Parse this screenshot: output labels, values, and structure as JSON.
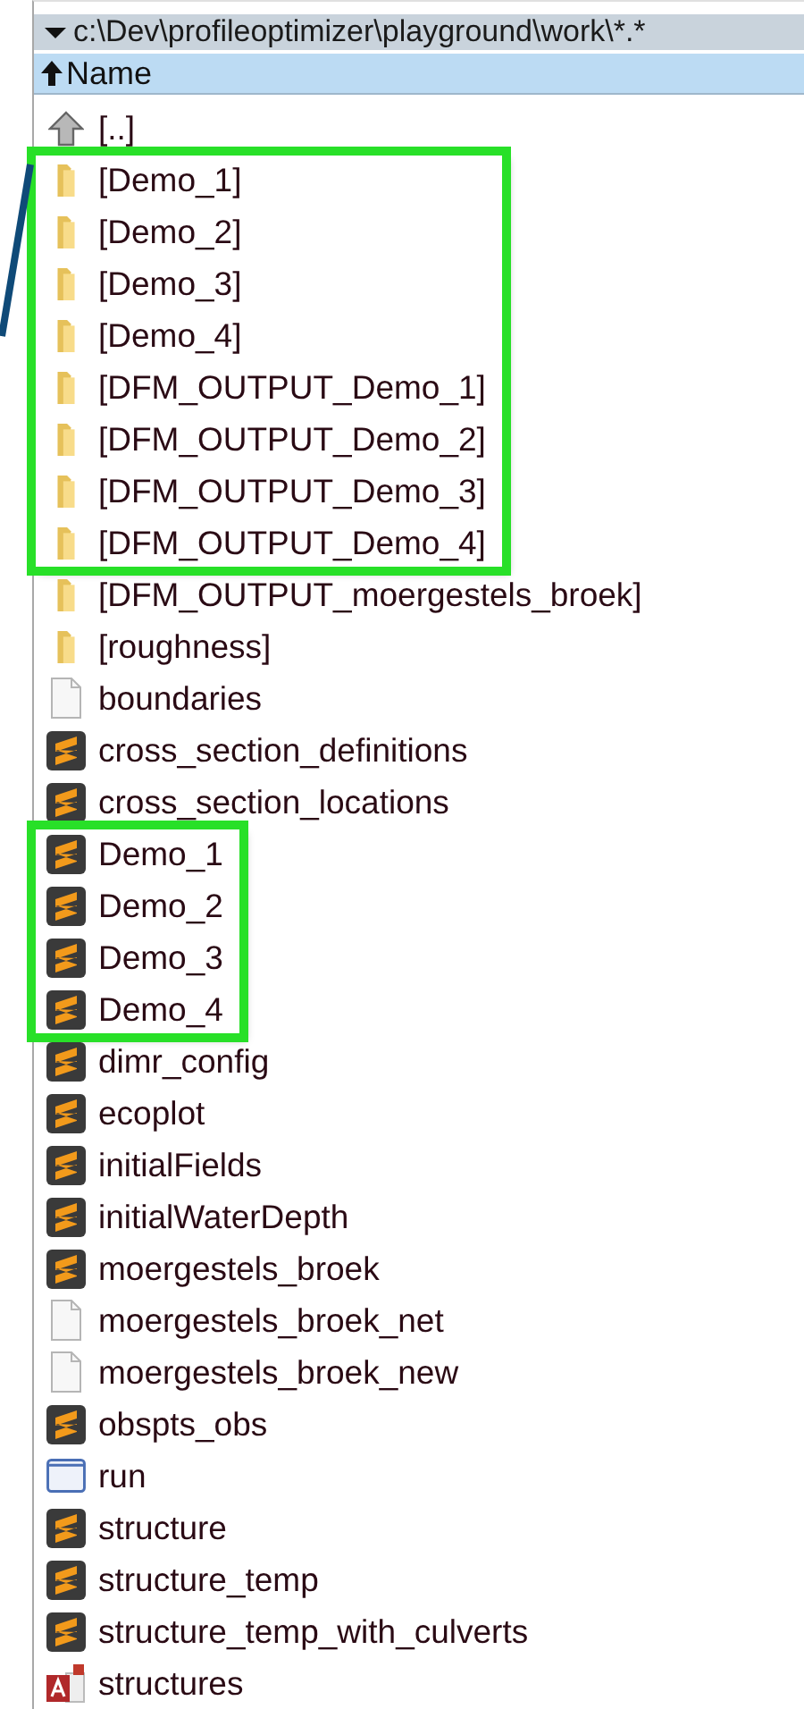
{
  "path_bar": {
    "path": "c:\\Dev\\profileoptimizer\\playground\\work\\*.*"
  },
  "header": {
    "column": "Name"
  },
  "sections": [
    {
      "highlighted": false,
      "items": [
        {
          "name": "[..]",
          "kind": "parent"
        }
      ]
    },
    {
      "highlighted": true,
      "items": [
        {
          "name": "[Demo_1]",
          "kind": "folder"
        },
        {
          "name": "[Demo_2]",
          "kind": "folder"
        },
        {
          "name": "[Demo_3]",
          "kind": "folder"
        },
        {
          "name": "[Demo_4]",
          "kind": "folder"
        },
        {
          "name": "[DFM_OUTPUT_Demo_1]",
          "kind": "folder"
        },
        {
          "name": "[DFM_OUTPUT_Demo_2]",
          "kind": "folder"
        },
        {
          "name": "[DFM_OUTPUT_Demo_3]",
          "kind": "folder"
        },
        {
          "name": "[DFM_OUTPUT_Demo_4]",
          "kind": "folder"
        }
      ]
    },
    {
      "highlighted": false,
      "items": [
        {
          "name": "[DFM_OUTPUT_moergestels_broek]",
          "kind": "folder"
        },
        {
          "name": "[roughness]",
          "kind": "folder"
        },
        {
          "name": "boundaries",
          "kind": "file"
        },
        {
          "name": "cross_section_definitions",
          "kind": "sublime"
        },
        {
          "name": "cross_section_locations",
          "kind": "sublime"
        }
      ]
    },
    {
      "highlighted": true,
      "items": [
        {
          "name": "Demo_1",
          "kind": "sublime"
        },
        {
          "name": "Demo_2",
          "kind": "sublime"
        },
        {
          "name": "Demo_3",
          "kind": "sublime"
        },
        {
          "name": "Demo_4",
          "kind": "sublime"
        }
      ]
    },
    {
      "highlighted": false,
      "items": [
        {
          "name": "dimr_config",
          "kind": "sublime"
        },
        {
          "name": "ecoplot",
          "kind": "sublime"
        },
        {
          "name": "initialFields",
          "kind": "sublime"
        },
        {
          "name": "initialWaterDepth",
          "kind": "sublime"
        },
        {
          "name": "moergestels_broek",
          "kind": "sublime"
        },
        {
          "name": "moergestels_broek_net",
          "kind": "file"
        },
        {
          "name": "moergestels_broek_new",
          "kind": "file"
        },
        {
          "name": "obspts_obs",
          "kind": "sublime"
        },
        {
          "name": "run",
          "kind": "window"
        },
        {
          "name": "structure",
          "kind": "sublime"
        },
        {
          "name": "structure_temp",
          "kind": "sublime"
        },
        {
          "name": "structure_temp_with_culverts",
          "kind": "sublime"
        },
        {
          "name": "structures",
          "kind": "access"
        }
      ]
    }
  ]
}
